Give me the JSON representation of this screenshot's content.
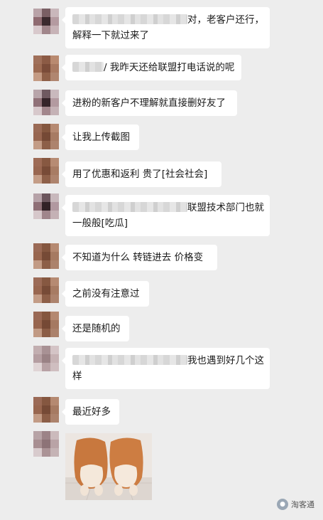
{
  "messages": [
    {
      "avatar_colors": [
        "#b9a3a8",
        "#7a5f64",
        "#c9b7bb",
        "#8f6b71",
        "#3b2a2e",
        "#b49aa0",
        "#d8c9cc",
        "#a1868b",
        "#c7b3b7"
      ],
      "blurred_prefix": true,
      "line1": "对，老客户还行，",
      "line2": "解释一下就过来了"
    },
    {
      "avatar_colors": [
        "#a0705a",
        "#8c5b45",
        "#b98a70",
        "#9c6a52",
        "#7b4c39",
        "#a97a62",
        "#c49b84",
        "#8f6048",
        "#b08670"
      ],
      "blurred_prefix": true,
      "line1": "/ 我昨天还给联盟打电话说的呢"
    },
    {
      "avatar_colors": [
        "#b8a5aa",
        "#6f5960",
        "#c9b9bd",
        "#907178",
        "#352429",
        "#b39aa0",
        "#d7c8cb",
        "#a2868c",
        "#c5b2b6"
      ],
      "line1": "进粉的新客户不理解就直接删好友了"
    },
    {
      "avatar_colors": [
        "#9a6a55",
        "#84573f",
        "#b68a72",
        "#976650",
        "#754935",
        "#a77b63",
        "#c39c86",
        "#8d5f48",
        "#ad836d"
      ],
      "line1": "让我上传截图"
    },
    {
      "avatar_colors": [
        "#9e6b56",
        "#875841",
        "#b78b73",
        "#996751",
        "#784b37",
        "#a87c64",
        "#c49d87",
        "#8e6049",
        "#ae846e"
      ],
      "line1": "用了优惠和返利   贵了[社会社会]"
    },
    {
      "avatar_colors": [
        "#b6a2a8",
        "#6c565d",
        "#c8b8bc",
        "#8e6f76",
        "#322226",
        "#b198a0",
        "#d6c7ca",
        "#a0858b",
        "#c4b1b5"
      ],
      "blurred_prefix": true,
      "line1": "联盟技术部门也就",
      "line2": "一般般[吃瓜]"
    },
    {
      "avatar_colors": [
        "#9b6a56",
        "#855740",
        "#b58971",
        "#98664f",
        "#764a36",
        "#a67a62",
        "#c29b85",
        "#8c5e47",
        "#ac826c"
      ],
      "line1": "不知道为什么  转链进去  价格变"
    },
    {
      "avatar_colors": [
        "#9c6b57",
        "#865841",
        "#b68a72",
        "#996750",
        "#774b37",
        "#a77b63",
        "#c39c86",
        "#8d5f48",
        "#ad836d"
      ],
      "line1": "之前没有注意过"
    },
    {
      "avatar_colors": [
        "#9a6955",
        "#84563f",
        "#b48870",
        "#97654e",
        "#754935",
        "#a57961",
        "#c19a84",
        "#8b5d46",
        "#ab816b"
      ],
      "line1": "还是随机的"
    },
    {
      "avatar_colors": [
        "#c2aeb0",
        "#a89194",
        "#d4c4c6",
        "#b59ea1",
        "#9a8285",
        "#c6b2b4",
        "#e0d4d5",
        "#b8a2a5",
        "#cfbec0"
      ],
      "blurred_prefix": true,
      "line1": "我也遇到好几个这",
      "line2": "样"
    },
    {
      "avatar_colors": [
        "#9b6a56",
        "#855740",
        "#b58971",
        "#98664f",
        "#764a36",
        "#a67a62",
        "#c29b85",
        "#8c5e47",
        "#ac826c"
      ],
      "line1": "最近好多"
    },
    {
      "avatar_colors": [
        "#b7a3a6",
        "#9c8387",
        "#cbbabc",
        "#a88f92",
        "#8d7377",
        "#b9a3a6",
        "#d8cbcd",
        "#ab9396",
        "#c5b3b5"
      ],
      "image": true
    }
  ],
  "watermark": {
    "icon": "wechat-official-icon",
    "text": "淘客通"
  }
}
